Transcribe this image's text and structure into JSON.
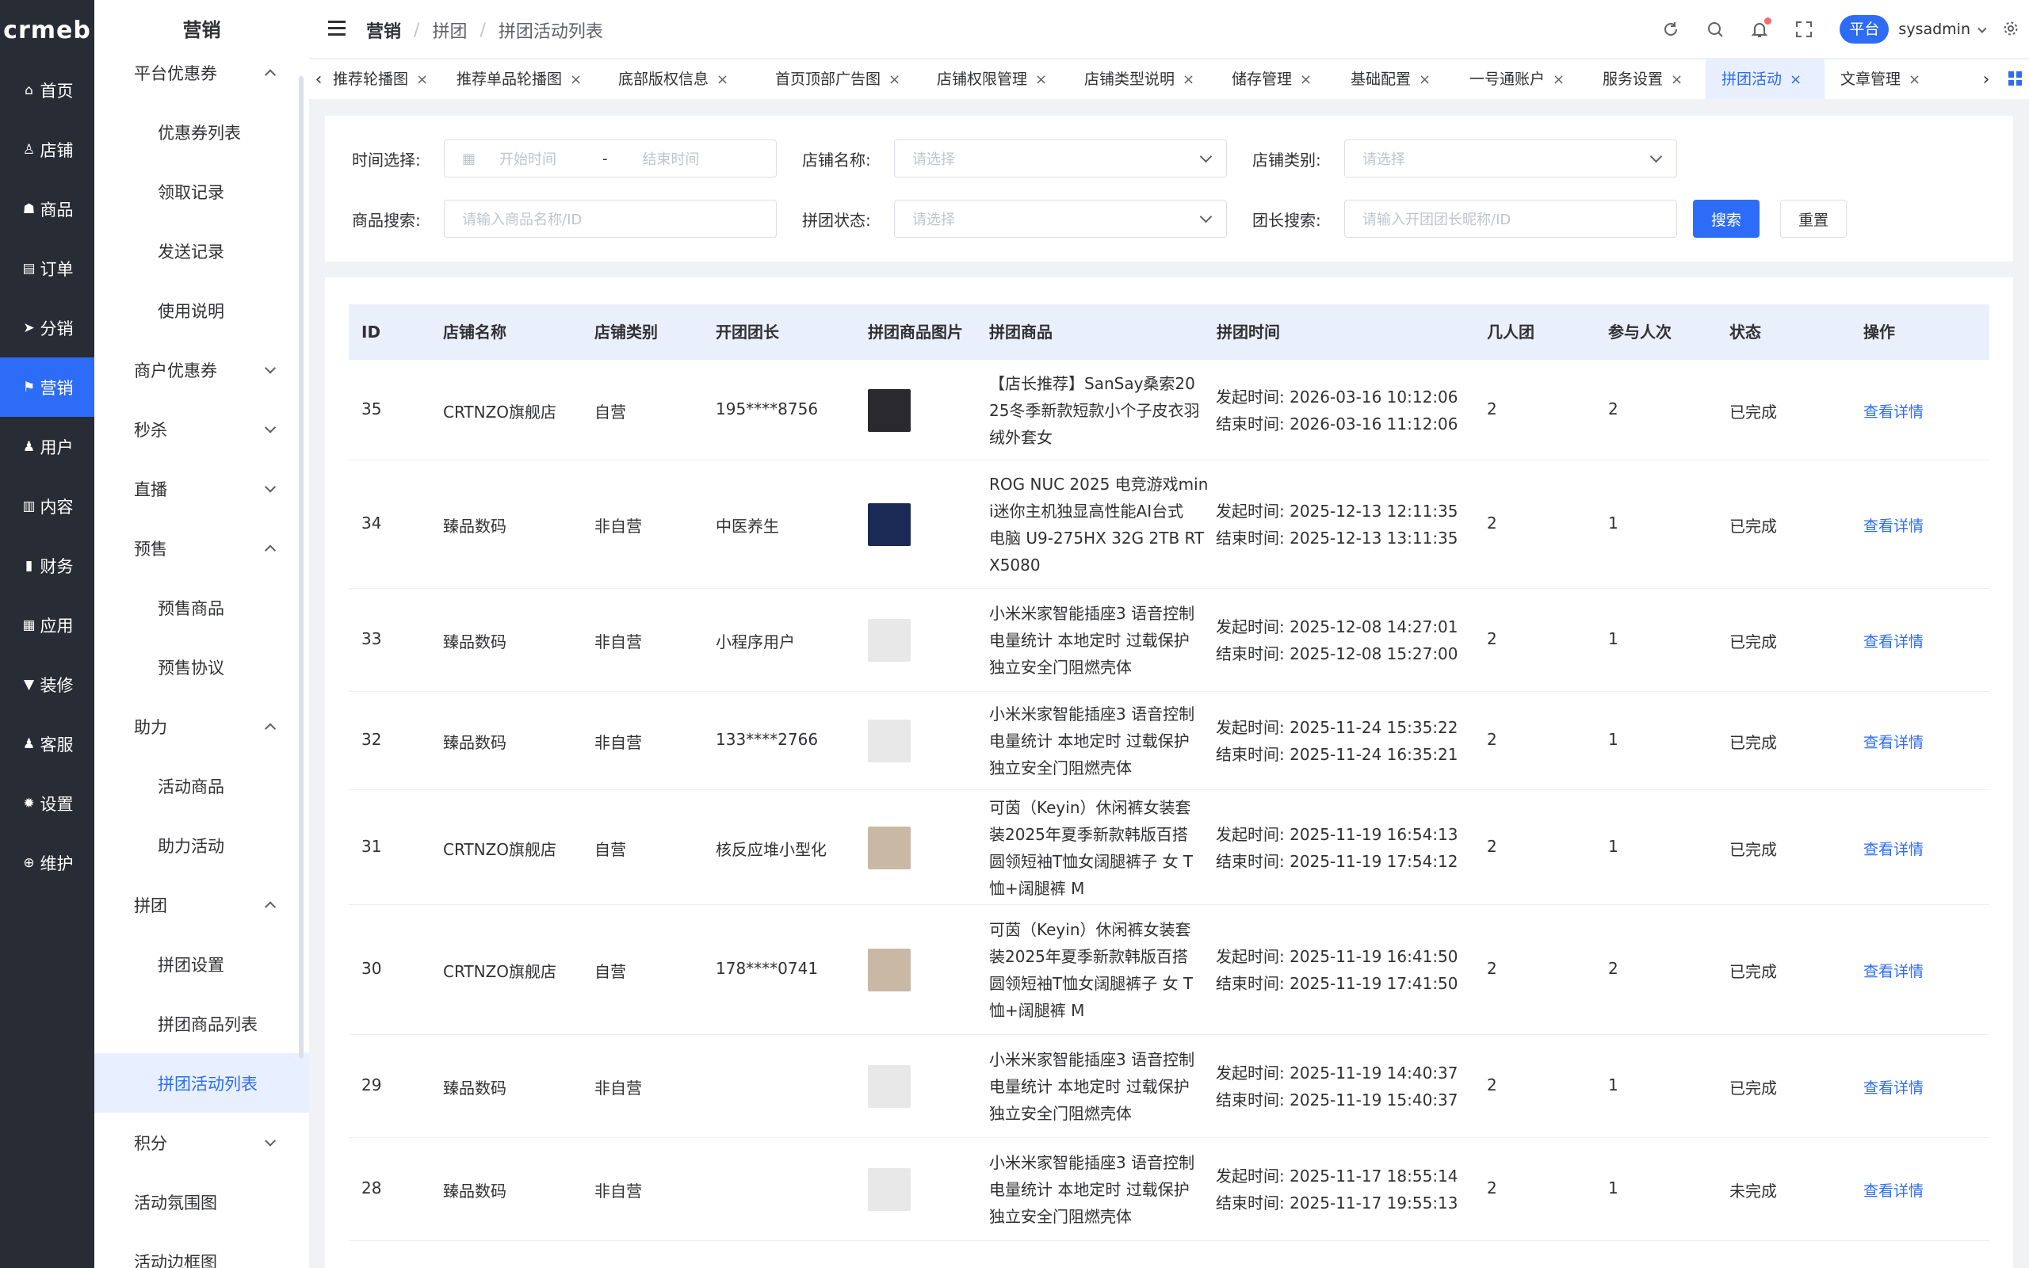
{
  "brand": {
    "logo": "crmeb"
  },
  "rail": [
    {
      "label": "首页",
      "icon": "home-icon",
      "glyph": "⌂",
      "active": false
    },
    {
      "label": "店铺",
      "icon": "store-icon",
      "glyph": "♙",
      "active": false
    },
    {
      "label": "商品",
      "icon": "goods-icon",
      "glyph": "☗",
      "active": false
    },
    {
      "label": "订单",
      "icon": "order-icon",
      "glyph": "▤",
      "active": false
    },
    {
      "label": "分销",
      "icon": "distribution-icon",
      "glyph": "➤",
      "active": false
    },
    {
      "label": "营销",
      "icon": "flag-icon",
      "glyph": "⚑",
      "active": true
    },
    {
      "label": "用户",
      "icon": "user-icon",
      "glyph": "♟",
      "active": false
    },
    {
      "label": "内容",
      "icon": "content-icon",
      "glyph": "▥",
      "active": false
    },
    {
      "label": "财务",
      "icon": "finance-icon",
      "glyph": "▮",
      "active": false
    },
    {
      "label": "应用",
      "icon": "apps-icon",
      "glyph": "▦",
      "active": false
    },
    {
      "label": "装修",
      "icon": "decorate-icon",
      "glyph": "▼",
      "active": false
    },
    {
      "label": "客服",
      "icon": "service-icon",
      "glyph": "♟",
      "active": false
    },
    {
      "label": "设置",
      "icon": "gear-icon",
      "glyph": "✹",
      "active": false
    },
    {
      "label": "维护",
      "icon": "maintain-icon",
      "glyph": "⊕",
      "active": false
    }
  ],
  "submenu": {
    "title": "营销",
    "items": [
      {
        "label": "平台优惠券",
        "kind": "grp",
        "chev": "up"
      },
      {
        "label": "优惠券列表",
        "kind": "sub"
      },
      {
        "label": "领取记录",
        "kind": "sub"
      },
      {
        "label": "发送记录",
        "kind": "sub"
      },
      {
        "label": "使用说明",
        "kind": "sub"
      },
      {
        "label": "商户优惠券",
        "kind": "grp",
        "chev": "down"
      },
      {
        "label": "秒杀",
        "kind": "grp",
        "chev": "down"
      },
      {
        "label": "直播",
        "kind": "grp",
        "chev": "down"
      },
      {
        "label": "预售",
        "kind": "grp",
        "chev": "up"
      },
      {
        "label": "预售商品",
        "kind": "sub"
      },
      {
        "label": "预售协议",
        "kind": "sub"
      },
      {
        "label": "助力",
        "kind": "grp",
        "chev": "up"
      },
      {
        "label": "活动商品",
        "kind": "sub"
      },
      {
        "label": "助力活动",
        "kind": "sub"
      },
      {
        "label": "拼团",
        "kind": "grp",
        "chev": "up"
      },
      {
        "label": "拼团设置",
        "kind": "sub"
      },
      {
        "label": "拼团商品列表",
        "kind": "sub"
      },
      {
        "label": "拼团活动列表",
        "kind": "sub",
        "active": true
      },
      {
        "label": "积分",
        "kind": "grp",
        "chev": "down"
      },
      {
        "label": "活动氛围图",
        "kind": "grp"
      },
      {
        "label": "活动边框图",
        "kind": "grp"
      }
    ]
  },
  "header": {
    "breadcrumb": [
      "营销",
      "拼团",
      "拼团活动列表"
    ],
    "platform_label": "平台",
    "username": "sysadmin"
  },
  "tabs": [
    {
      "label": "推荐轮播图"
    },
    {
      "label": "推荐单品轮播图"
    },
    {
      "label": "底部版权信息"
    },
    {
      "label": "首页顶部广告图"
    },
    {
      "label": "店铺权限管理"
    },
    {
      "label": "店铺类型说明"
    },
    {
      "label": "储存管理"
    },
    {
      "label": "基础配置"
    },
    {
      "label": "一号通账户"
    },
    {
      "label": "服务设置"
    },
    {
      "label": "拼团活动",
      "active": true
    },
    {
      "label": "文章管理"
    }
  ],
  "filters": {
    "time_label": "时间选择:",
    "start_placeholder": "开始时间",
    "range_sep": "-",
    "end_placeholder": "结束时间",
    "store_name_label": "店铺名称:",
    "store_name_placeholder": "请选择",
    "store_type_label": "店铺类别:",
    "store_type_placeholder": "请选择",
    "goods_label": "商品搜索:",
    "goods_placeholder": "请输入商品名称/ID",
    "status_label": "拼团状态:",
    "status_placeholder": "请选择",
    "leader_label": "团长搜索:",
    "leader_placeholder": "请输入开团团长昵称/ID",
    "search_button": "搜索",
    "reset_button": "重置"
  },
  "table": {
    "columns": [
      "ID",
      "店铺名称",
      "店铺类别",
      "开团团长",
      "拼团商品图片",
      "拼团商品",
      "拼团时间",
      "几人团",
      "参与人次",
      "状态",
      "操作"
    ],
    "rows": [
      {
        "id": "35",
        "store": "CRTNZO旗舰店",
        "type": "自营",
        "leader": "195****8756",
        "thumb": "#2a2a2e",
        "product": [
          "【店长推荐】SanSay桑索20",
          "25冬季新款短款小个子皮衣羽",
          "绒外套女"
        ],
        "start": "发起时间:  2026-03-16 10:12:06",
        "end": "结束时间:  2026-03-16 11:12:06",
        "size": "2",
        "joined": "2",
        "status": "已完成",
        "action": "查看详情"
      },
      {
        "id": "34",
        "store": "臻品数码",
        "type": "非自营",
        "leader": "中医养生",
        "thumb": "#1b2a55",
        "product": [
          "ROG NUC 2025 电竞游戏min",
          "i迷你主机独显高性能AI台式",
          "电脑 U9-275HX 32G 2TB RT",
          "X5080"
        ],
        "start": "发起时间:  2025-12-13 12:11:35",
        "end": "结束时间:  2025-12-13 13:11:35",
        "size": "2",
        "joined": "1",
        "status": "已完成",
        "action": "查看详情"
      },
      {
        "id": "33",
        "store": "臻品数码",
        "type": "非自营",
        "leader": "小程序用户",
        "thumb": "#e8e8e8",
        "product": [
          "小米米家智能插座3 语音控制",
          "电量统计 本地定时 过载保护",
          "独立安全门阻燃壳体"
        ],
        "start": "发起时间:  2025-12-08 14:27:01",
        "end": "结束时间:  2025-12-08 15:27:00",
        "size": "2",
        "joined": "1",
        "status": "已完成",
        "action": "查看详情"
      },
      {
        "id": "32",
        "store": "臻品数码",
        "type": "非自营",
        "leader": "133****2766",
        "thumb": "#e8e8e8",
        "product": [
          "小米米家智能插座3 语音控制",
          "电量统计 本地定时 过载保护",
          "独立安全门阻燃壳体"
        ],
        "start": "发起时间:  2025-11-24 15:35:22",
        "end": "结束时间:  2025-11-24 16:35:21",
        "size": "2",
        "joined": "1",
        "status": "已完成",
        "action": "查看详情"
      },
      {
        "id": "31",
        "store": "CRTNZO旗舰店",
        "type": "自营",
        "leader": "核反应堆小型化",
        "thumb": "#c9b8a4",
        "product": [
          "可茵（Keyin）休闲裤女装套",
          "装2025年夏季新款韩版百搭",
          "圆领短袖T恤女阔腿裤子 女 T",
          "恤+阔腿裤 M"
        ],
        "start": "发起时间:  2025-11-19 16:54:13",
        "end": "结束时间:  2025-11-19 17:54:12",
        "size": "2",
        "joined": "1",
        "status": "已完成",
        "action": "查看详情"
      },
      {
        "id": "30",
        "store": "CRTNZO旗舰店",
        "type": "自营",
        "leader": "178****0741",
        "thumb": "#c9b8a4",
        "product": [
          "可茵（Keyin）休闲裤女装套",
          "装2025年夏季新款韩版百搭",
          "圆领短袖T恤女阔腿裤子 女 T",
          "恤+阔腿裤 M"
        ],
        "start": "发起时间:  2025-11-19 16:41:50",
        "end": "结束时间:  2025-11-19 17:41:50",
        "size": "2",
        "joined": "2",
        "status": "已完成",
        "action": "查看详情"
      },
      {
        "id": "29",
        "store": "臻品数码",
        "type": "非自营",
        "leader": "",
        "thumb": "#e8e8e8",
        "product": [
          "小米米家智能插座3 语音控制",
          "电量统计 本地定时 过载保护",
          "独立安全门阻燃壳体"
        ],
        "start": "发起时间:  2025-11-19 14:40:37",
        "end": "结束时间:  2025-11-19 15:40:37",
        "size": "2",
        "joined": "1",
        "status": "已完成",
        "action": "查看详情"
      },
      {
        "id": "28",
        "store": "臻品数码",
        "type": "非自营",
        "leader": "",
        "thumb": "#e8e8e8",
        "product": [
          "小米米家智能插座3 语音控制",
          "电量统计 本地定时 过载保护",
          "独立安全门阻燃壳体"
        ],
        "start": "发起时间:  2025-11-17 18:55:14",
        "end": "结束时间:  2025-11-17 19:55:13",
        "size": "2",
        "joined": "1",
        "status": "未完成",
        "action": "查看详情"
      }
    ]
  }
}
